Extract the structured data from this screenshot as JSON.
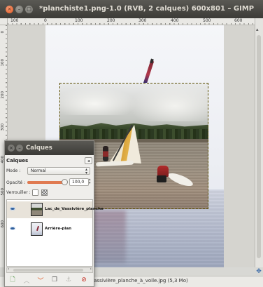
{
  "window": {
    "title": "*planchiste1.png-1.0 (RVB, 2 calques) 600x801 – GIMP",
    "controls": {
      "close": "×",
      "minimize": "–",
      "maximize": "□"
    }
  },
  "ruler": {
    "h_labels": [
      "100",
      "0",
      "100",
      "200",
      "300",
      "400",
      "500",
      "600"
    ],
    "v_labels": [
      "0",
      "100",
      "200",
      "300",
      "400",
      "500",
      "600"
    ]
  },
  "status": {
    "text": "Vassivière_planche_à_voile.jpg (5,3 Mo)"
  },
  "layers_dock": {
    "title": "Calques",
    "tab_label": "Calques",
    "tab_menu": "◂",
    "mode_label": "Mode :",
    "mode_value": "Normal",
    "opacity_label": "Opacité :",
    "opacity_value": "100,0",
    "opacity_percent": 100,
    "lock_label": "Verrouiller :",
    "layers": [
      {
        "name": "Lac_de_Vassivière_planche",
        "visible": true,
        "selected": true
      },
      {
        "name": "Arrière-plan",
        "visible": true,
        "selected": false
      }
    ],
    "toolbar_icons": [
      "new-layer-icon",
      "raise-layer-icon",
      "lower-layer-icon",
      "duplicate-layer-icon",
      "anchor-layer-icon",
      "delete-layer-icon"
    ]
  },
  "colors": {
    "titlebar": "#3c3b37",
    "accent": "#e07a50",
    "selection": "#e0c000"
  }
}
